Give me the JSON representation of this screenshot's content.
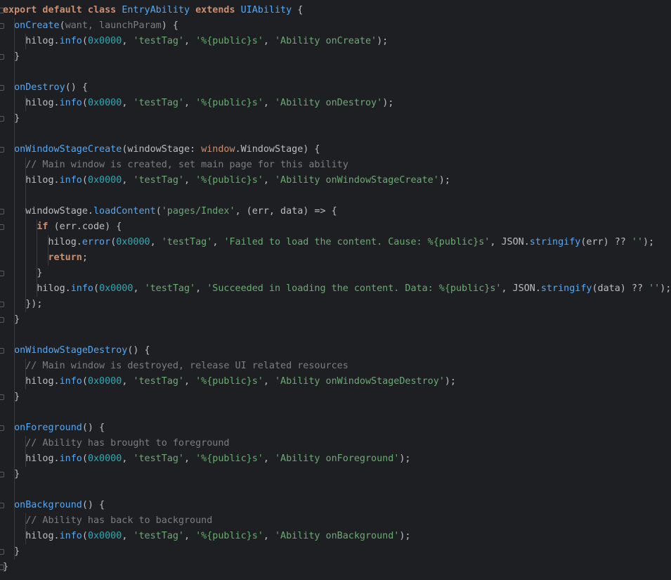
{
  "editor": {
    "lines": [
      [
        [
          "kw",
          "export default class "
        ],
        [
          "cls",
          "EntryAbility"
        ],
        [
          "kw",
          " extends "
        ],
        [
          "cls",
          "UIAbility"
        ],
        [
          "tip",
          " {"
        ]
      ],
      [
        [
          "tip",
          "  "
        ],
        [
          "fn",
          "onCreate"
        ],
        [
          "tip",
          "("
        ],
        [
          "mut",
          "want, launchParam"
        ],
        [
          "tip",
          ") {"
        ]
      ],
      [
        [
          "tip",
          "    hilog."
        ],
        [
          "mth",
          "info"
        ],
        [
          "tip",
          "("
        ],
        [
          "num",
          "0x0000"
        ],
        [
          "tip",
          ", "
        ],
        [
          "str",
          "'testTag'"
        ],
        [
          "tip",
          ", "
        ],
        [
          "str",
          "'%{public}s'"
        ],
        [
          "tip",
          ", "
        ],
        [
          "str",
          "'Ability onCreate'"
        ],
        [
          "tip",
          ");"
        ]
      ],
      [
        [
          "tip",
          "  }"
        ]
      ],
      [
        [
          "tip",
          ""
        ]
      ],
      [
        [
          "tip",
          "  "
        ],
        [
          "fn",
          "onDestroy"
        ],
        [
          "tip",
          "() {"
        ]
      ],
      [
        [
          "tip",
          "    hilog."
        ],
        [
          "mth",
          "info"
        ],
        [
          "tip",
          "("
        ],
        [
          "num",
          "0x0000"
        ],
        [
          "tip",
          ", "
        ],
        [
          "str",
          "'testTag'"
        ],
        [
          "tip",
          ", "
        ],
        [
          "str",
          "'%{public}s'"
        ],
        [
          "tip",
          ", "
        ],
        [
          "str",
          "'Ability onDestroy'"
        ],
        [
          "tip",
          ");"
        ]
      ],
      [
        [
          "tip",
          "  }"
        ]
      ],
      [
        [
          "tip",
          ""
        ]
      ],
      [
        [
          "tip",
          "  "
        ],
        [
          "fn",
          "onWindowStageCreate"
        ],
        [
          "tip",
          "(windowStage: "
        ],
        [
          "win",
          "window"
        ],
        [
          "tip",
          ".WindowStage) {"
        ]
      ],
      [
        [
          "cm",
          "    // Main window is created, set main page for this ability"
        ]
      ],
      [
        [
          "tip",
          "    hilog."
        ],
        [
          "mth",
          "info"
        ],
        [
          "tip",
          "("
        ],
        [
          "num",
          "0x0000"
        ],
        [
          "tip",
          ", "
        ],
        [
          "str",
          "'testTag'"
        ],
        [
          "tip",
          ", "
        ],
        [
          "str",
          "'%{public}s'"
        ],
        [
          "tip",
          ", "
        ],
        [
          "str",
          "'Ability onWindowStageCreate'"
        ],
        [
          "tip",
          ");"
        ]
      ],
      [
        [
          "tip",
          ""
        ]
      ],
      [
        [
          "tip",
          "    windowStage."
        ],
        [
          "mth",
          "loadContent"
        ],
        [
          "tip",
          "("
        ],
        [
          "str",
          "'pages/Index'"
        ],
        [
          "tip",
          ", (err, data) => {"
        ]
      ],
      [
        [
          "kw",
          "      if "
        ],
        [
          "tip",
          "(err.code) {"
        ]
      ],
      [
        [
          "tip",
          "        hilog."
        ],
        [
          "mth",
          "error"
        ],
        [
          "tip",
          "("
        ],
        [
          "num",
          "0x0000"
        ],
        [
          "tip",
          ", "
        ],
        [
          "str",
          "'testTag'"
        ],
        [
          "tip",
          ", "
        ],
        [
          "str",
          "'Failed to load the content. Cause: %{public}s'"
        ],
        [
          "tip",
          ", JSON."
        ],
        [
          "mth",
          "stringify"
        ],
        [
          "tip",
          "(err) ?? "
        ],
        [
          "str",
          "''"
        ],
        [
          "tip",
          ");"
        ]
      ],
      [
        [
          "kw",
          "        return"
        ],
        [
          "tip",
          ";"
        ]
      ],
      [
        [
          "tip",
          "      }"
        ]
      ],
      [
        [
          "tip",
          "      hilog."
        ],
        [
          "mth",
          "info"
        ],
        [
          "tip",
          "("
        ],
        [
          "num",
          "0x0000"
        ],
        [
          "tip",
          ", "
        ],
        [
          "str",
          "'testTag'"
        ],
        [
          "tip",
          ", "
        ],
        [
          "str",
          "'Succeeded in loading the content. Data: %{public}s'"
        ],
        [
          "tip",
          ", JSON."
        ],
        [
          "mth",
          "stringify"
        ],
        [
          "tip",
          "(data) ?? "
        ],
        [
          "str",
          "''"
        ],
        [
          "tip",
          ");"
        ]
      ],
      [
        [
          "tip",
          "    });"
        ]
      ],
      [
        [
          "tip",
          "  }"
        ]
      ],
      [
        [
          "tip",
          ""
        ]
      ],
      [
        [
          "tip",
          "  "
        ],
        [
          "fn",
          "onWindowStageDestroy"
        ],
        [
          "tip",
          "() {"
        ]
      ],
      [
        [
          "cm",
          "    // Main window is destroyed, release UI related resources"
        ]
      ],
      [
        [
          "tip",
          "    hilog."
        ],
        [
          "mth",
          "info"
        ],
        [
          "tip",
          "("
        ],
        [
          "num",
          "0x0000"
        ],
        [
          "tip",
          ", "
        ],
        [
          "str",
          "'testTag'"
        ],
        [
          "tip",
          ", "
        ],
        [
          "str",
          "'%{public}s'"
        ],
        [
          "tip",
          ", "
        ],
        [
          "str",
          "'Ability onWindowStageDestroy'"
        ],
        [
          "tip",
          ");"
        ]
      ],
      [
        [
          "tip",
          "  }"
        ]
      ],
      [
        [
          "tip",
          ""
        ]
      ],
      [
        [
          "tip",
          "  "
        ],
        [
          "fn",
          "onForeground"
        ],
        [
          "tip",
          "() {"
        ]
      ],
      [
        [
          "cm",
          "    // Ability has brought to foreground"
        ]
      ],
      [
        [
          "tip",
          "    hilog."
        ],
        [
          "mth",
          "info"
        ],
        [
          "tip",
          "("
        ],
        [
          "num",
          "0x0000"
        ],
        [
          "tip",
          ", "
        ],
        [
          "str",
          "'testTag'"
        ],
        [
          "tip",
          ", "
        ],
        [
          "str",
          "'%{public}s'"
        ],
        [
          "tip",
          ", "
        ],
        [
          "str",
          "'Ability onForeground'"
        ],
        [
          "tip",
          ");"
        ]
      ],
      [
        [
          "tip",
          "  }"
        ]
      ],
      [
        [
          "tip",
          ""
        ]
      ],
      [
        [
          "tip",
          "  "
        ],
        [
          "fn",
          "onBackground"
        ],
        [
          "tip",
          "() {"
        ]
      ],
      [
        [
          "cm",
          "    // Ability has back to background"
        ]
      ],
      [
        [
          "tip",
          "    hilog."
        ],
        [
          "mth",
          "info"
        ],
        [
          "tip",
          "("
        ],
        [
          "num",
          "0x0000"
        ],
        [
          "tip",
          ", "
        ],
        [
          "str",
          "'testTag'"
        ],
        [
          "tip",
          ", "
        ],
        [
          "str",
          "'%{public}s'"
        ],
        [
          "tip",
          ", "
        ],
        [
          "str",
          "'Ability onBackground'"
        ],
        [
          "tip",
          ");"
        ]
      ],
      [
        [
          "tip",
          "  }"
        ]
      ],
      [
        [
          "tip",
          "}"
        ]
      ]
    ],
    "fold_markers": [
      0,
      1,
      3,
      5,
      7,
      9,
      13,
      14,
      17,
      19,
      20,
      22,
      25,
      27,
      30,
      32,
      35,
      36
    ],
    "colors": {
      "background": "#1e1f22",
      "keyword": "#cf8e6d",
      "function": "#56a8f5",
      "string": "#6aab73",
      "number": "#2aacb8",
      "comment": "#7a7e85",
      "text": "#bcbec4"
    }
  }
}
